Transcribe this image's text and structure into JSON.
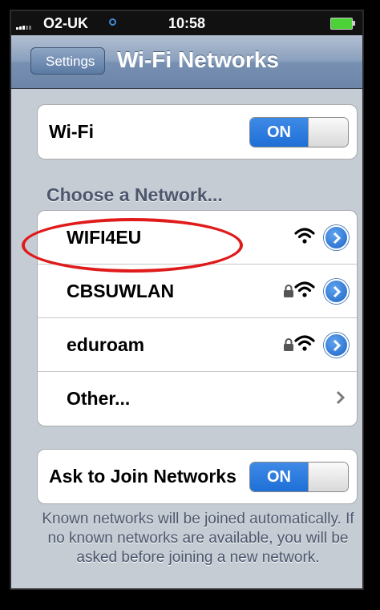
{
  "status_bar": {
    "carrier": "O2-UK",
    "time": "10:58"
  },
  "nav": {
    "back_label": "Settings",
    "title": "Wi-Fi Networks"
  },
  "wifi_row": {
    "label": "Wi-Fi",
    "toggle": "ON"
  },
  "section_header": "Choose a Network...",
  "networks": [
    {
      "name": "WIFI4EU",
      "locked": false
    },
    {
      "name": "CBSUWLAN",
      "locked": true
    },
    {
      "name": "eduroam",
      "locked": true
    }
  ],
  "other_label": "Other...",
  "ask_row": {
    "label": "Ask to Join Networks",
    "toggle": "ON"
  },
  "footer_text": "Known networks will be joined automatically.  If no known networks are available, you will be asked before joining a new network.",
  "colors": {
    "accent": "#1f6fd6",
    "annotation": "#e01b1b"
  }
}
